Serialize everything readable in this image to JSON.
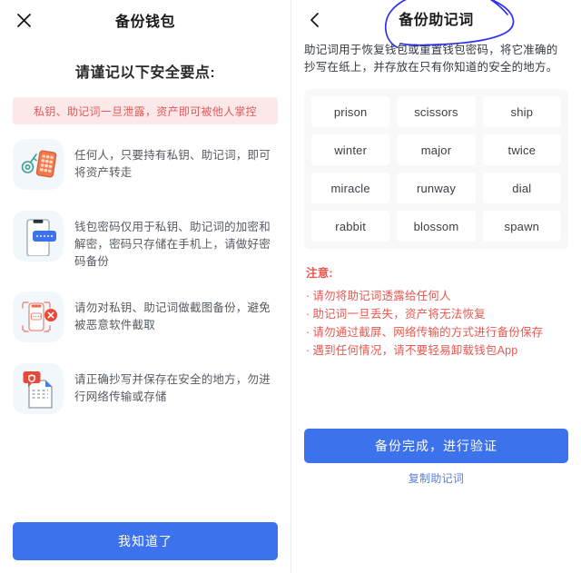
{
  "colors": {
    "primary": "#3c72ec",
    "alert_bg": "#fbe9e9",
    "alert_text": "#e05a5a",
    "note_text": "#e7584f",
    "card_bg": "#ffffff",
    "grid_bg": "#f7f8fa",
    "icon_bg": "#f2f7fb",
    "link": "#5b7fd4",
    "scribble": "#2f2ff0"
  },
  "left": {
    "close_icon": "close-icon",
    "title": "备份钱包",
    "heading": "请谨记以下安全要点:",
    "alert": "私钥、助记词一旦泄露，资产即可被他人掌控",
    "tips": [
      {
        "icon": "key-keypad-icon",
        "text": "任何人，只要持有私钥、助记词，即可将资产转走"
      },
      {
        "icon": "phone-password-icon",
        "text": "钱包密码仅用于私钥、助记词的加密和解密，密码只存储在手机上，请做好密码备份"
      },
      {
        "icon": "no-screenshot-icon",
        "text": "请勿对私钥、助记词做截图备份，避免被恶意软件截取"
      },
      {
        "icon": "secure-document-icon",
        "text": "请正确抄写并保存在安全的地方，勿进行网络传输或存储"
      }
    ],
    "confirm_button": "我知道了"
  },
  "right": {
    "back_icon": "back-chevron-icon",
    "title": "备份助记词",
    "annotation": "hand-drawn-circle",
    "description": "助记词用于恢复钱包或重置钱包密码，将它准确的抄写在纸上，并存放在只有你知道的安全的地方。",
    "mnemonic_words": [
      "prison",
      "scissors",
      "ship",
      "winter",
      "major",
      "twice",
      "miracle",
      "runway",
      "dial",
      "rabbit",
      "blossom",
      "spawn"
    ],
    "notes_title": "注意:",
    "notes": [
      "请勿将助记词透露给任何人",
      "助记词一旦丢失，资产将无法恢复",
      "请勿通过截屏、网络传输的方式进行备份保存",
      "遇到任何情况，请不要轻易卸载钱包App"
    ],
    "primary_button": "备份完成，进行验证",
    "copy_link": "复制助记词"
  }
}
